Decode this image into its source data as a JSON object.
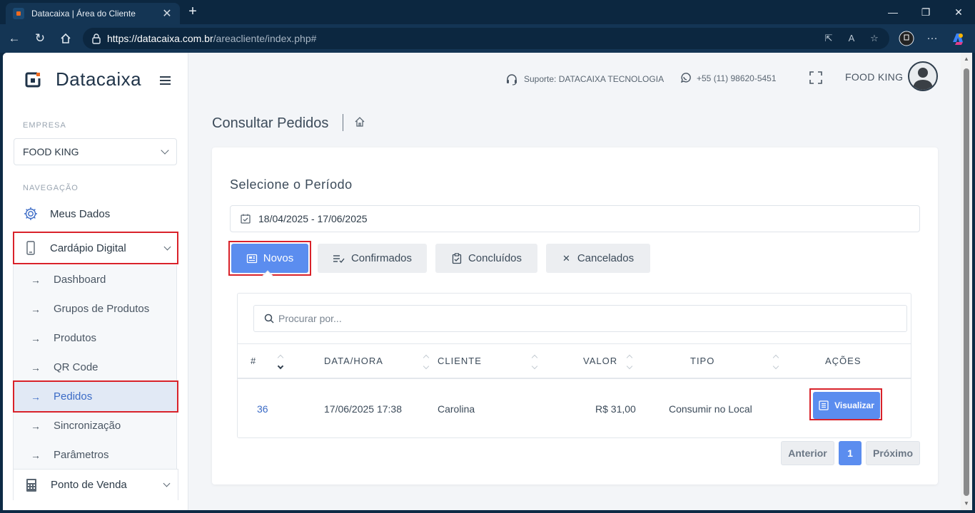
{
  "browser": {
    "tab_title": "Datacaixa | Área do Cliente",
    "url_host": "https://datacaixa.com.br",
    "url_path": "/areacliente/index.php#"
  },
  "brand": {
    "name": "Datacaixa",
    "accent": "#f06a1f"
  },
  "sidebar": {
    "empresa_label": "EMPRESA",
    "empresa_value": "FOOD KING",
    "nav_label": "NAVEGAÇÃO",
    "items": [
      {
        "label": "Meus Dados",
        "icon": "gear-icon"
      },
      {
        "label": "Cardápio Digital",
        "icon": "smartphone-icon"
      },
      {
        "label": "Ponto de Venda",
        "icon": "calculator-icon"
      }
    ],
    "submenu": [
      {
        "label": "Dashboard"
      },
      {
        "label": "Grupos de Produtos"
      },
      {
        "label": "Produtos"
      },
      {
        "label": "QR Code"
      },
      {
        "label": "Pedidos"
      },
      {
        "label": "Sincronização"
      },
      {
        "label": "Parâmetros"
      }
    ]
  },
  "header": {
    "support": "Suporte: DATACAIXA TECNOLOGIA",
    "phone": "+55 (11) 98620-5451",
    "user": "FOOD KING"
  },
  "main": {
    "title": "Consultar Pedidos",
    "period_label": "Selecione o Período",
    "date_range": "18/04/2025 - 17/06/2025",
    "status_tabs": [
      {
        "label": "Novos"
      },
      {
        "label": "Confirmados"
      },
      {
        "label": "Concluídos"
      },
      {
        "label": "Cancelados"
      }
    ],
    "search_placeholder": "Procurar por...",
    "columns": [
      "#",
      "DATA/HORA",
      "CLIENTE",
      "VALOR",
      "TIPO",
      "AÇÕES"
    ],
    "rows": [
      {
        "id": "36",
        "datetime": "17/06/2025 17:38",
        "client": "Carolina",
        "value": "R$ 31,00",
        "type": "Consumir no Local",
        "action": "Visualizar"
      }
    ],
    "pager": {
      "prev": "Anterior",
      "current": "1",
      "next": "Próximo"
    }
  }
}
